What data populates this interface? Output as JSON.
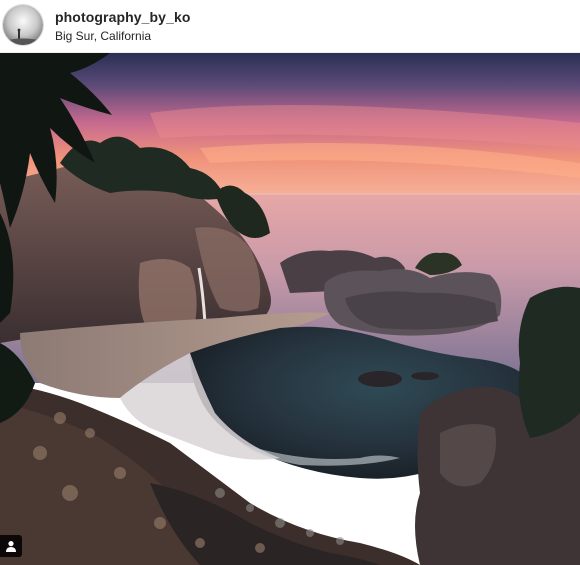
{
  "post": {
    "username": "photography_by_ko",
    "location": "Big Sur, California"
  },
  "icons": {
    "avatar": "profile-photo",
    "tag": "user-tag-icon"
  },
  "colors": {
    "username": "#262626",
    "location": "#262626",
    "header_bg": "#ffffff"
  }
}
